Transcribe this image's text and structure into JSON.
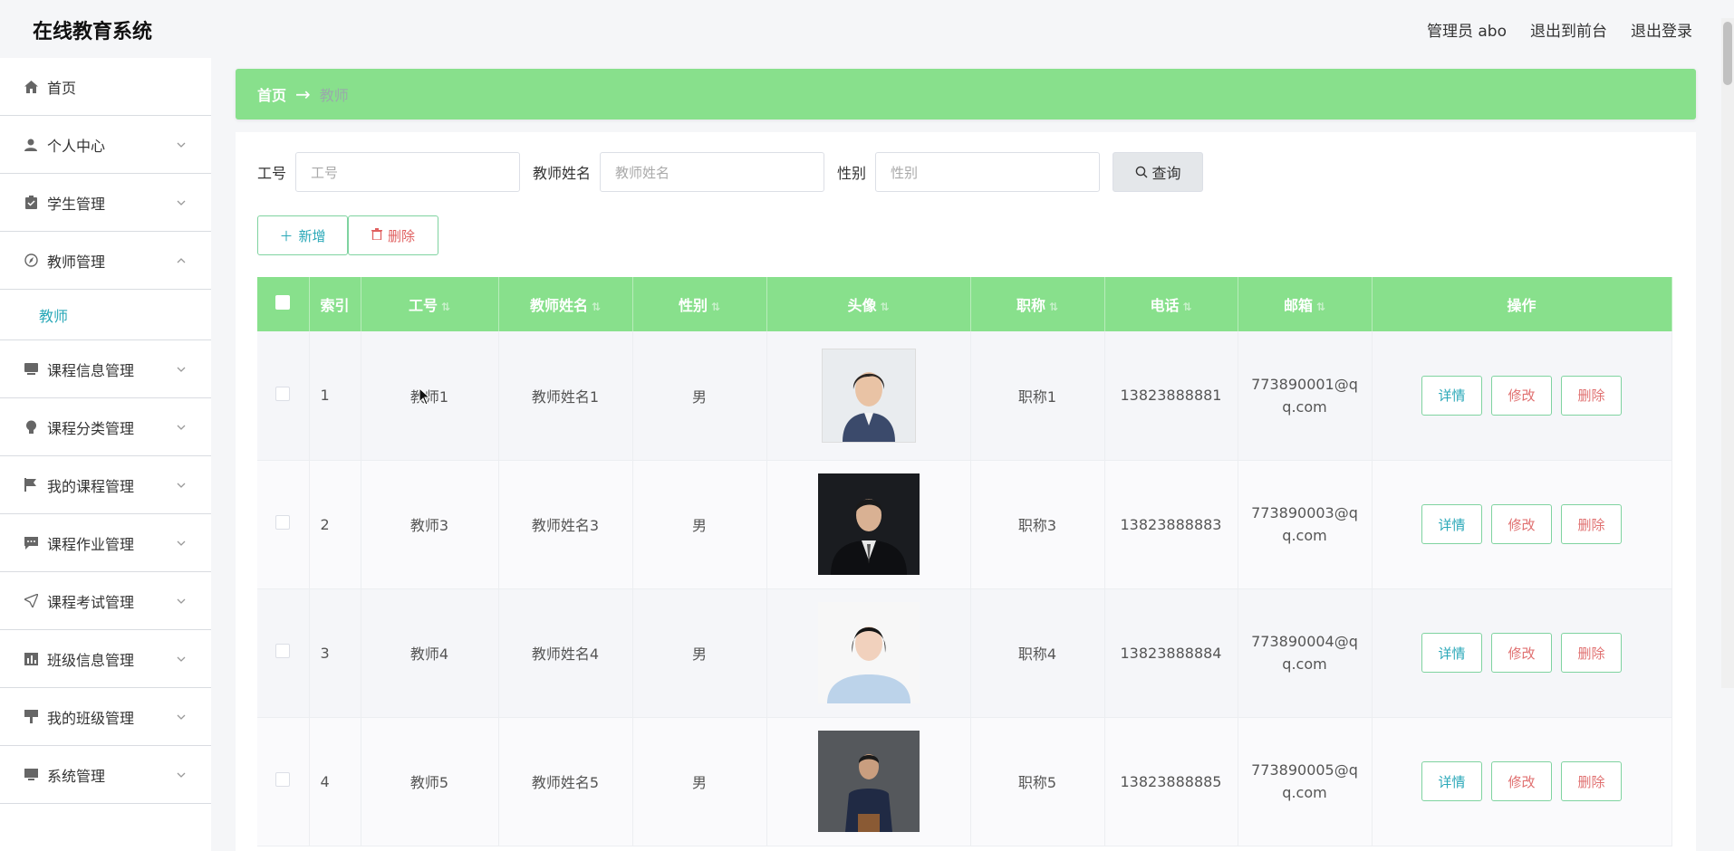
{
  "header": {
    "brand": "在线教育系统",
    "user": "管理员 abo",
    "to_front": "退出到前台",
    "logout": "退出登录"
  },
  "sidebar": {
    "items": [
      {
        "label": "首页",
        "icon": "home-icon"
      },
      {
        "label": "个人中心",
        "icon": "user-icon"
      },
      {
        "label": "学生管理",
        "icon": "clipboard-icon"
      },
      {
        "label": "教师管理",
        "icon": "compass-icon"
      },
      {
        "label": "课程信息管理",
        "icon": "tablet-icon"
      },
      {
        "label": "课程分类管理",
        "icon": "bulb-icon"
      },
      {
        "label": "我的课程管理",
        "icon": "flag-icon"
      },
      {
        "label": "课程作业管理",
        "icon": "chat-icon"
      },
      {
        "label": "课程考试管理",
        "icon": "send-icon"
      },
      {
        "label": "班级信息管理",
        "icon": "chart-icon"
      },
      {
        "label": "我的班级管理",
        "icon": "podium-icon"
      },
      {
        "label": "系统管理",
        "icon": "monitor-icon"
      }
    ],
    "sub_active": "教师"
  },
  "breadcrumb": {
    "home": "首页",
    "arrow": "→",
    "current": "教师"
  },
  "filters": {
    "id_label": "工号",
    "id_placeholder": "工号",
    "name_label": "教师姓名",
    "name_placeholder": "教师姓名",
    "gender_label": "性别",
    "gender_placeholder": "性别",
    "query": "查询"
  },
  "actions": {
    "add": "新增",
    "delete": "删除"
  },
  "table": {
    "headers": {
      "index": "索引",
      "id": "工号",
      "name": "教师姓名",
      "gender": "性别",
      "avatar": "头像",
      "title": "职称",
      "phone": "电话",
      "email": "邮箱",
      "ops": "操作"
    },
    "rows": [
      {
        "index": "1",
        "id": "教师1",
        "name": "教师姓名1",
        "gender": "男",
        "title": "职称1",
        "phone": "13823888881",
        "email": "773890001@qq.com"
      },
      {
        "index": "2",
        "id": "教师3",
        "name": "教师姓名3",
        "gender": "男",
        "title": "职称3",
        "phone": "13823888883",
        "email": "773890003@qq.com"
      },
      {
        "index": "3",
        "id": "教师4",
        "name": "教师姓名4",
        "gender": "男",
        "title": "职称4",
        "phone": "13823888884",
        "email": "773890004@qq.com"
      },
      {
        "index": "4",
        "id": "教师5",
        "name": "教师姓名5",
        "gender": "男",
        "title": "职称5",
        "phone": "13823888885",
        "email": "773890005@qq.com"
      }
    ],
    "op_labels": {
      "detail": "详情",
      "edit": "修改",
      "remove": "删除"
    }
  },
  "colors": {
    "accent_green": "#88e08c",
    "link_teal": "#2aa8b8",
    "danger_red": "#e06060"
  }
}
